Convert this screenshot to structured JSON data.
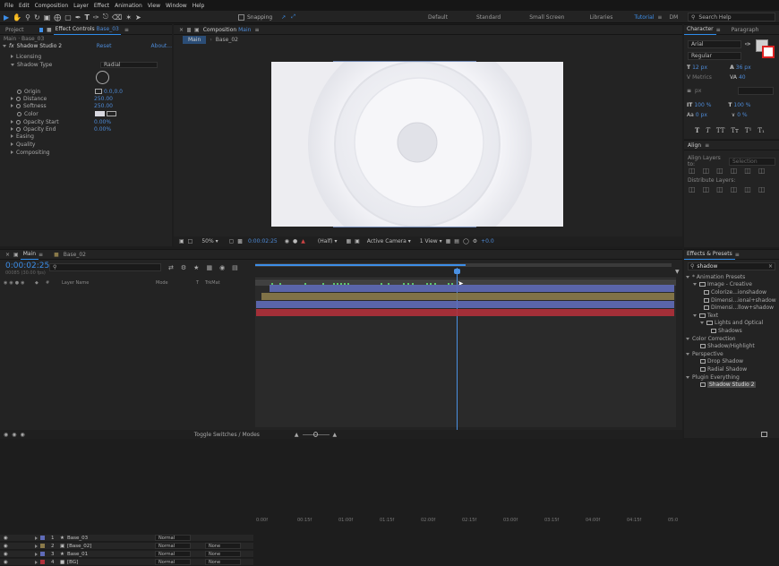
{
  "menu": [
    "File",
    "Edit",
    "Composition",
    "Layer",
    "Effect",
    "Animation",
    "View",
    "Window",
    "Help"
  ],
  "toolbar": {
    "snapping": "Snapping",
    "workspaces": [
      "Default",
      "Standard",
      "Small Screen",
      "Libraries",
      "Tutorial",
      "DM"
    ],
    "active_workspace": "Tutorial",
    "search": "Search Help"
  },
  "left_tabs": {
    "project": "Project",
    "effect_controls": "Effect Controls",
    "effect_layer": "Base_03"
  },
  "effect_controls": {
    "path": "Main · Base_03",
    "reset": "Reset",
    "about": "About...",
    "effect_name": "Shadow Studio 2",
    "props": [
      {
        "label": "Licensing",
        "value": ""
      },
      {
        "label": "Shadow Type",
        "value": "Radial"
      },
      {
        "label": "Origin",
        "value": "0.0,0.0"
      },
      {
        "label": "Distance",
        "value": "250.00"
      },
      {
        "label": "Softness",
        "value": "250.00"
      },
      {
        "label": "Color",
        "value": ""
      },
      {
        "label": "Opacity Start",
        "value": "0.00%"
      },
      {
        "label": "Opacity End",
        "value": "0.00%"
      },
      {
        "label": "Easing",
        "value": ""
      },
      {
        "label": "Quality",
        "value": ""
      },
      {
        "label": "Compositing",
        "value": ""
      }
    ]
  },
  "composition": {
    "tab": "Composition",
    "name": "Main",
    "crumbs": [
      "Main",
      "Base_02"
    ],
    "footer": {
      "zoom": "50%",
      "time": "0:00:02:25",
      "res": "(Half)",
      "camera": "Active Camera",
      "view": "1 View",
      "exposure": "+0.0"
    }
  },
  "character": {
    "tab": "Character",
    "paragraph_tab": "Paragraph",
    "font": "Arial",
    "style": "Regular",
    "size": "12 px",
    "leading": "36 px",
    "kerning": "Metrics",
    "tracking": "40",
    "stroke": "px",
    "vscale": "100 %",
    "hscale": "100 %",
    "baseline": "0 px",
    "tsume": "0 %"
  },
  "align": {
    "title": "Align",
    "align_to_label": "Align Layers to:",
    "align_to_value": "Selection",
    "distribute": "Distribute Layers:"
  },
  "effects_presets": {
    "title": "Effects & Presets",
    "search": "shadow",
    "tree": [
      {
        "label": "* Animation Presets",
        "depth": 0
      },
      {
        "label": "Image - Creative",
        "depth": 1
      },
      {
        "label": "Colorize...ionshadow",
        "depth": 2
      },
      {
        "label": "Dimensi...ional+shadow",
        "depth": 2
      },
      {
        "label": "Dimensi...llow+shadow",
        "depth": 2
      },
      {
        "label": "Text",
        "depth": 1
      },
      {
        "label": "Lights and Optical",
        "depth": 2
      },
      {
        "label": "Shadows",
        "depth": 3
      },
      {
        "label": "Color Correction",
        "depth": 0
      },
      {
        "label": "Shadow/Highlight",
        "depth": 1
      },
      {
        "label": "Perspective",
        "depth": 0
      },
      {
        "label": "Drop Shadow",
        "depth": 1
      },
      {
        "label": "Radial Shadow",
        "depth": 1
      },
      {
        "label": "Plugin Everything",
        "depth": 0
      },
      {
        "label": "Shadow Studio 2",
        "depth": 1
      }
    ]
  },
  "timeline": {
    "tabs": [
      "Main",
      "Base_02"
    ],
    "time": "0:00:02:25",
    "frames": "00085 (30.00 fps)",
    "columns": {
      "layer_name": "Layer Name",
      "mode": "Mode",
      "t": "T",
      "trkmat": "TrkMat"
    },
    "ticks": [
      "0:00f",
      "00:15f",
      "01:00f",
      "01:15f",
      "02:00f",
      "02:15f",
      "03:00f",
      "03:15f",
      "04:00f",
      "04:15f",
      "05:0"
    ],
    "layers": [
      {
        "num": "1",
        "name": "Base_03",
        "mode": "Normal",
        "trkmat": "",
        "color": "#5f6bb8"
      },
      {
        "num": "2",
        "name": "[Base_02]",
        "mode": "Normal",
        "trkmat": "None",
        "color": "#8a7a4a"
      },
      {
        "num": "3",
        "name": "Base_01",
        "mode": "Normal",
        "trkmat": "None",
        "color": "#5f6bb8"
      },
      {
        "num": "4",
        "name": "[BG]",
        "mode": "Normal",
        "trkmat": "None",
        "color": "#b0303a"
      }
    ],
    "footer": "Toggle Switches / Modes"
  }
}
